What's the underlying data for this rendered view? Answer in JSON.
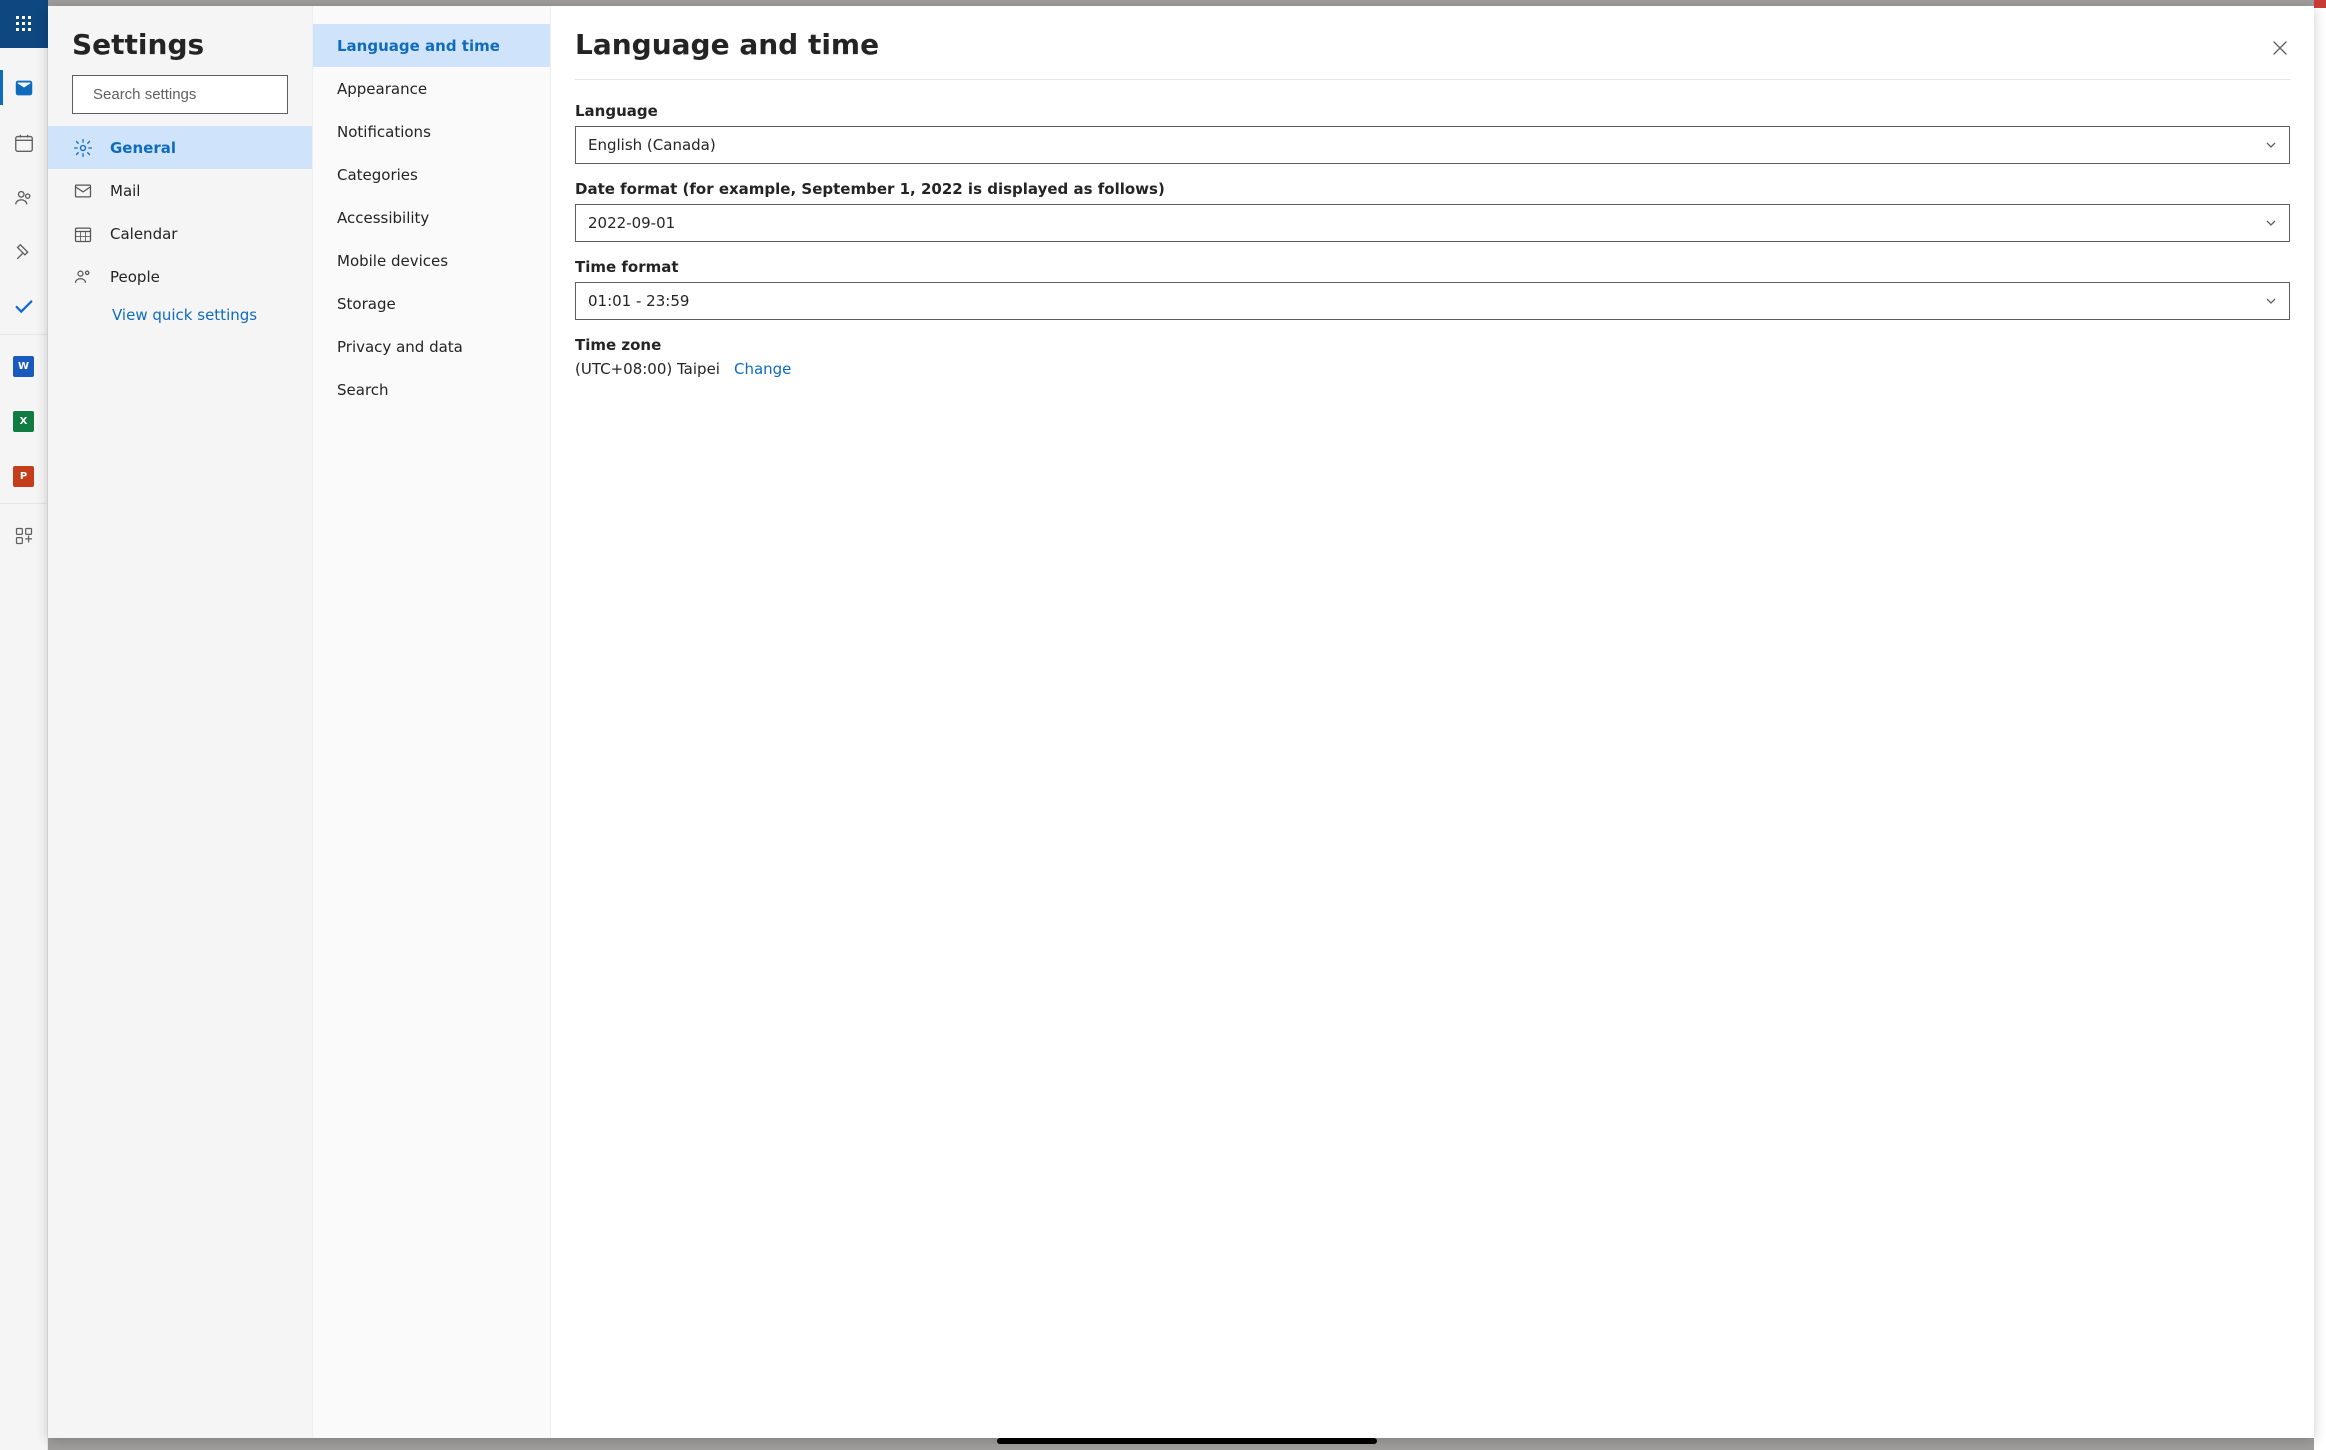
{
  "app_rail": {
    "items": [
      {
        "name": "mail-icon",
        "sel": true
      },
      {
        "name": "calendar-icon"
      },
      {
        "name": "people-icon"
      },
      {
        "name": "files-icon"
      },
      {
        "name": "todo-icon",
        "divider_after": true
      },
      {
        "name": "word-icon"
      },
      {
        "name": "excel-icon"
      },
      {
        "name": "powerpoint-icon",
        "divider_after": true
      },
      {
        "name": "apps-icon"
      }
    ]
  },
  "settings": {
    "title": "Settings",
    "search_placeholder": "Search settings",
    "categories": [
      {
        "label": "General",
        "icon": "gear-icon",
        "sel": true
      },
      {
        "label": "Mail",
        "icon": "mail-icon"
      },
      {
        "label": "Calendar",
        "icon": "calendar-grid-icon"
      },
      {
        "label": "People",
        "icon": "people-icon"
      }
    ],
    "quick_link": "View quick settings",
    "subcategories": [
      {
        "label": "Language and time",
        "sel": true
      },
      {
        "label": "Appearance"
      },
      {
        "label": "Notifications"
      },
      {
        "label": "Categories"
      },
      {
        "label": "Accessibility"
      },
      {
        "label": "Mobile devices"
      },
      {
        "label": "Storage"
      },
      {
        "label": "Privacy and data"
      },
      {
        "label": "Search"
      }
    ]
  },
  "page": {
    "title": "Language and time",
    "language_label": "Language",
    "language_value": "English (Canada)",
    "dateformat_label": "Date format (for example, September 1, 2022 is displayed as follows)",
    "dateformat_value": "2022-09-01",
    "timeformat_label": "Time format",
    "timeformat_value": "01:01 - 23:59",
    "timezone_label": "Time zone",
    "timezone_value": "(UTC+08:00) Taipei",
    "timezone_change": "Change"
  }
}
